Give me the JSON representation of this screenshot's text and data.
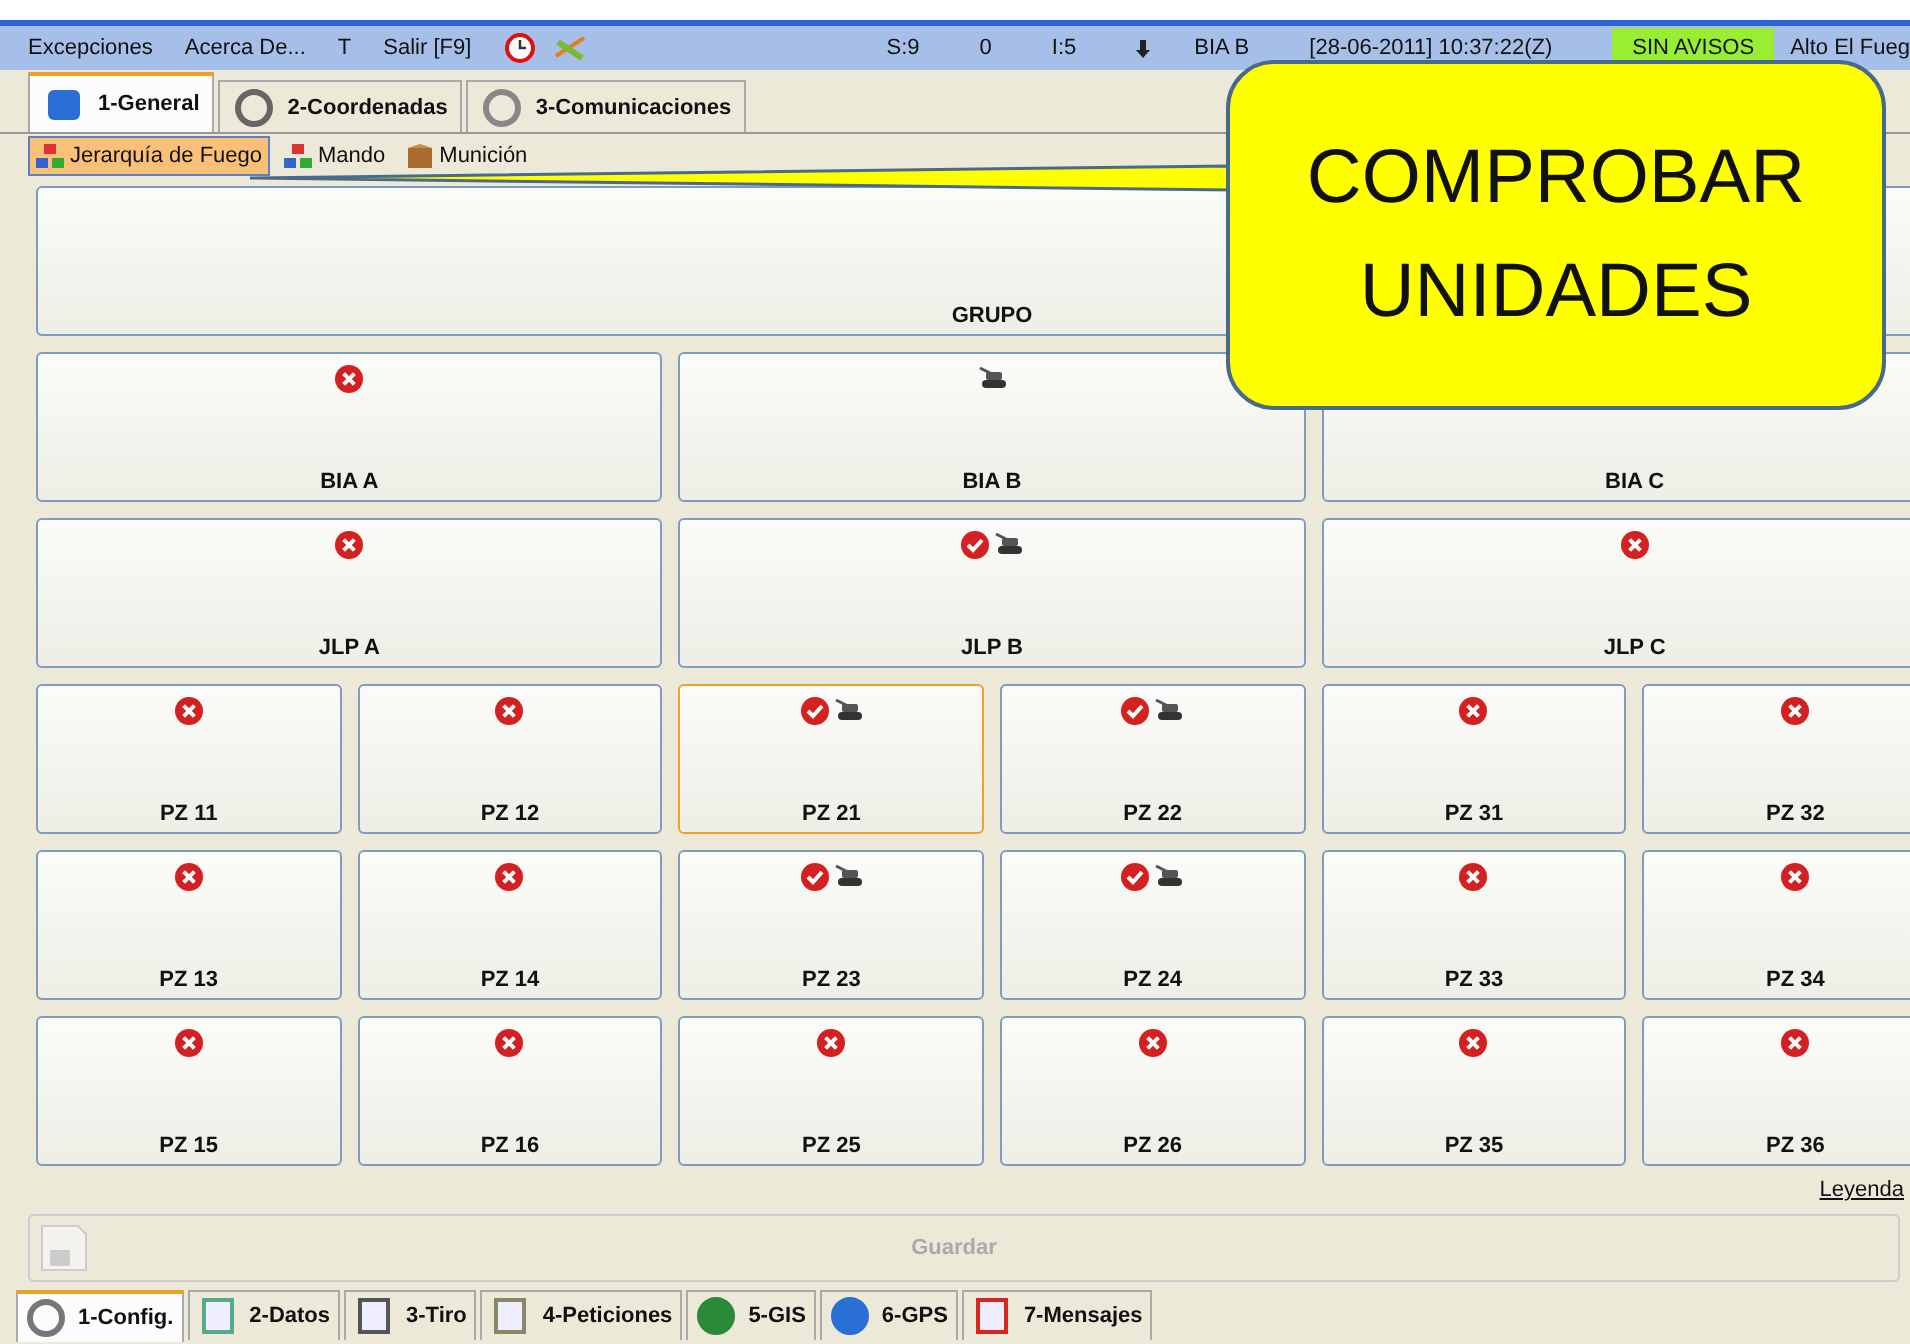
{
  "menu": [
    {
      "label": "Excepciones"
    },
    {
      "label": "Acerca De..."
    },
    {
      "label": "T"
    },
    {
      "label": "Salir [F9]"
    }
  ],
  "status_bar": {
    "s": "S:9",
    "count": "0",
    "i": "I:5",
    "unit": "BIA B",
    "datetime": "[28-06-2011] 10:37:22(Z)",
    "alerts": "SIN AVISOS",
    "mode": "Alto El Fueg"
  },
  "tabs": [
    {
      "label": "1-General",
      "selected": true
    },
    {
      "label": "2-Coordenadas",
      "selected": false
    },
    {
      "label": "3-Comunicaciones",
      "selected": false
    }
  ],
  "subtabs": [
    {
      "label": "Jerarquía de Fuego",
      "selected": true
    },
    {
      "label": "Mando",
      "selected": false
    },
    {
      "label": "Munición",
      "selected": false
    }
  ],
  "grid": {
    "rows": [
      {
        "cards": [
          {
            "label": "GRUPO",
            "error": false,
            "checked": false,
            "vehicle": false,
            "selected": false
          }
        ]
      },
      {
        "cards": [
          {
            "label": "BIA A",
            "error": true,
            "checked": false,
            "vehicle": false,
            "selected": false
          },
          {
            "label": "BIA B",
            "error": false,
            "checked": false,
            "vehicle": true,
            "selected": false
          },
          {
            "label": "BIA C",
            "error": false,
            "checked": false,
            "vehicle": false,
            "selected": false
          }
        ]
      },
      {
        "cards": [
          {
            "label": "JLP A",
            "error": true,
            "checked": false,
            "vehicle": false,
            "selected": false
          },
          {
            "label": "JLP B",
            "error": false,
            "checked": true,
            "vehicle": true,
            "selected": false
          },
          {
            "label": "JLP C",
            "error": true,
            "checked": false,
            "vehicle": false,
            "selected": false
          }
        ]
      },
      {
        "cards": [
          {
            "label": "PZ 11",
            "error": true,
            "checked": false,
            "vehicle": false,
            "selected": false
          },
          {
            "label": "PZ 12",
            "error": true,
            "checked": false,
            "vehicle": false,
            "selected": false
          },
          {
            "label": "PZ 21",
            "error": false,
            "checked": true,
            "vehicle": true,
            "selected": true
          },
          {
            "label": "PZ 22",
            "error": false,
            "checked": true,
            "vehicle": true,
            "selected": false
          },
          {
            "label": "PZ 31",
            "error": true,
            "checked": false,
            "vehicle": false,
            "selected": false
          },
          {
            "label": "PZ 32",
            "error": true,
            "checked": false,
            "vehicle": false,
            "selected": false
          }
        ]
      },
      {
        "cards": [
          {
            "label": "PZ 13",
            "error": true,
            "checked": false,
            "vehicle": false,
            "selected": false
          },
          {
            "label": "PZ 14",
            "error": true,
            "checked": false,
            "vehicle": false,
            "selected": false
          },
          {
            "label": "PZ 23",
            "error": false,
            "checked": true,
            "vehicle": true,
            "selected": false
          },
          {
            "label": "PZ 24",
            "error": false,
            "checked": true,
            "vehicle": true,
            "selected": false
          },
          {
            "label": "PZ 33",
            "error": true,
            "checked": false,
            "vehicle": false,
            "selected": false
          },
          {
            "label": "PZ 34",
            "error": true,
            "checked": false,
            "vehicle": false,
            "selected": false
          }
        ]
      },
      {
        "cards": [
          {
            "label": "PZ 15",
            "error": true,
            "checked": false,
            "vehicle": false,
            "selected": false
          },
          {
            "label": "PZ 16",
            "error": true,
            "checked": false,
            "vehicle": false,
            "selected": false
          },
          {
            "label": "PZ 25",
            "error": true,
            "checked": false,
            "vehicle": false,
            "selected": false
          },
          {
            "label": "PZ 26",
            "error": true,
            "checked": false,
            "vehicle": false,
            "selected": false
          },
          {
            "label": "PZ 35",
            "error": true,
            "checked": false,
            "vehicle": false,
            "selected": false
          },
          {
            "label": "PZ 36",
            "error": true,
            "checked": false,
            "vehicle": false,
            "selected": false
          }
        ]
      }
    ]
  },
  "legend_link": "Leyenda",
  "save_button": {
    "label": "Guardar",
    "disabled": true
  },
  "bottom_tabs": [
    {
      "label": "1-Config.",
      "selected": true
    },
    {
      "label": "2-Datos",
      "selected": false
    },
    {
      "label": "3-Tiro",
      "selected": false
    },
    {
      "label": "4-Peticiones",
      "selected": false
    },
    {
      "label": "5-GIS",
      "selected": false
    },
    {
      "label": "6-GPS",
      "selected": false
    },
    {
      "label": "7-Mensajes",
      "selected": false
    }
  ],
  "callout": {
    "text": "COMPROBAR UNIDADES"
  }
}
